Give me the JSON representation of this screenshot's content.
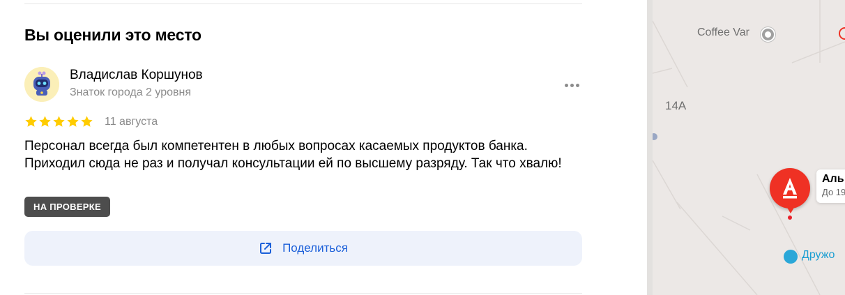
{
  "section": {
    "title": "Вы оценили это место"
  },
  "review": {
    "author": {
      "name": "Владислав Коршунов",
      "level": "Знаток города 2 уровня"
    },
    "rating": 5,
    "rating_max": 5,
    "date": "11 августа",
    "text": "Персонал всегда был компетентен в любых вопросах касаемых продуктов банка. Приходил сюда не раз и получал консультации ей по высшему разряду. Так что хвалю!",
    "status": "НА ПРОВЕРКЕ"
  },
  "actions": {
    "share_label": "Поделиться"
  },
  "map": {
    "poi_coffee": "Coffee Var",
    "house_number": "14А",
    "bank_name": "Аль",
    "bank_hours": "До 19",
    "metro_label": "Дружо"
  },
  "colors": {
    "star": "#fc0",
    "badge": "#4d4d4d",
    "link": "#1a5fd9",
    "bank_brand": "#ef3124",
    "metro": "#2aa7d8"
  },
  "icons": {
    "share": "share-icon",
    "more": "more-dots-icon",
    "avatar": "robot-avatar-icon",
    "bank_logo": "alfa-bank-logo-icon",
    "metro": "metro-icon"
  }
}
